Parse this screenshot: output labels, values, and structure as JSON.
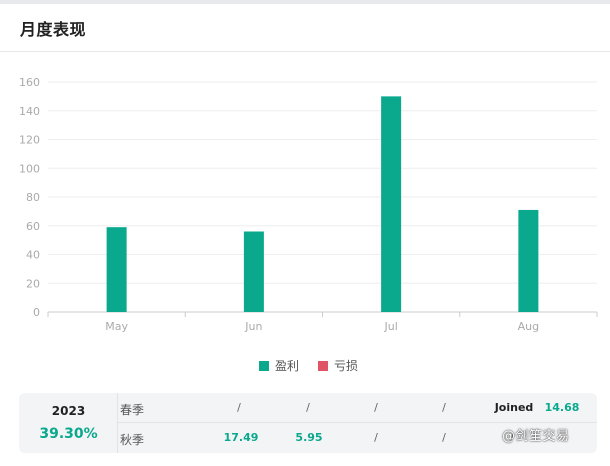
{
  "header": {
    "title": "月度表现"
  },
  "chart_data": {
    "type": "bar",
    "categories": [
      "May",
      "Jun",
      "Jul",
      "Aug"
    ],
    "series": [
      {
        "name": "盈利",
        "color": "#0aa88c",
        "values": [
          59,
          56,
          150,
          71
        ]
      },
      {
        "name": "亏损",
        "color": "#e05566",
        "values": [
          0,
          0,
          0,
          0
        ]
      }
    ],
    "yticks": [
      "0",
      "20",
      "40",
      "60",
      "80",
      "100",
      "120",
      "140",
      "160"
    ],
    "ylim": [
      0,
      160
    ],
    "grid": true,
    "legend_position": "bottom"
  },
  "legend": [
    {
      "label": "盈利",
      "color": "#0aa88c"
    },
    {
      "label": "亏损",
      "color": "#e05566"
    }
  ],
  "stats": {
    "year": "2023",
    "year_return": "39.30%",
    "rows": [
      {
        "label": "春季",
        "cells": [
          "/",
          "/",
          "/",
          "/",
          "Joined",
          "14.68"
        ]
      },
      {
        "label": "秋季",
        "cells": [
          "17.49",
          "5.95",
          "/",
          "/",
          "/",
          ""
        ]
      }
    ]
  },
  "watermark": "@剑笙交易"
}
